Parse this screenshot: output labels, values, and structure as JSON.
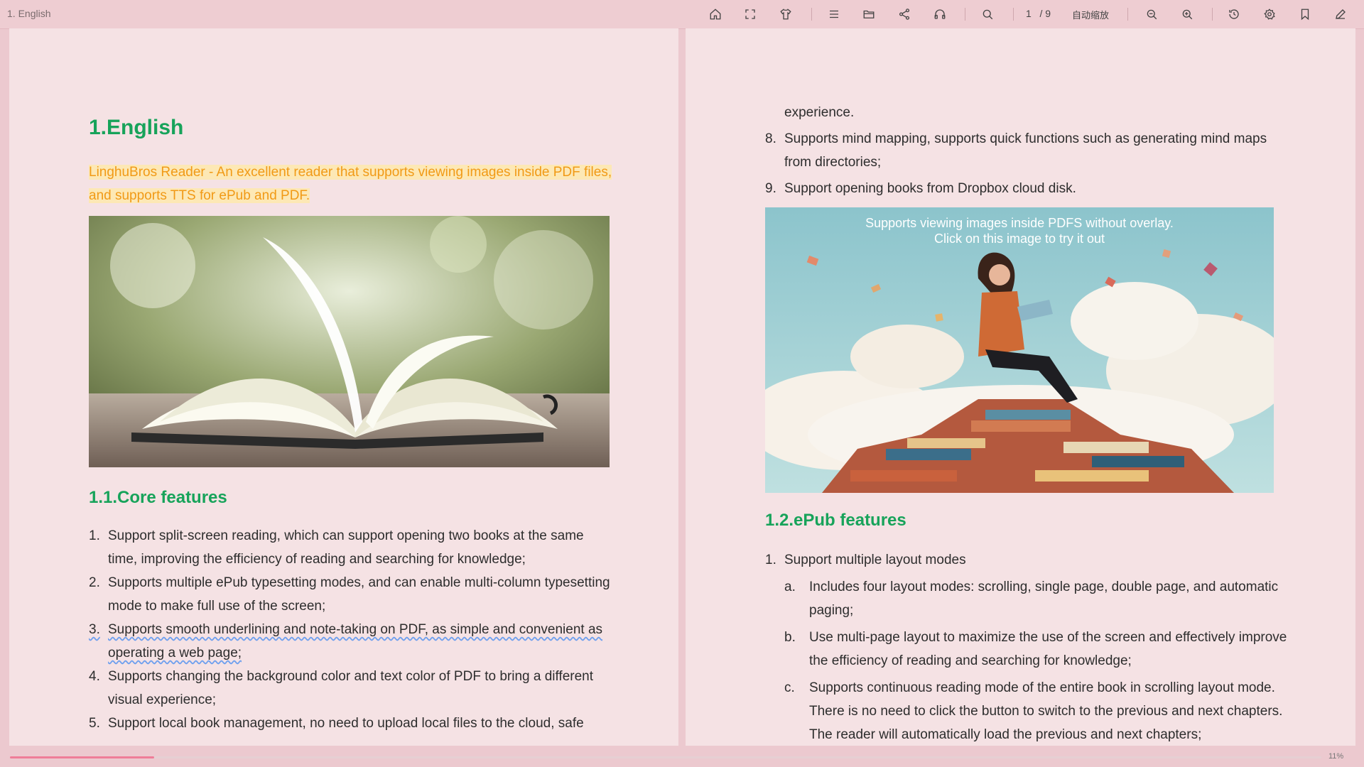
{
  "toolbar": {
    "chapter_title": "1. English",
    "current_page": "1",
    "page_total": "/ 9",
    "zoom_label": "自动缩放"
  },
  "progress": {
    "fraction": 0.11,
    "label": "11%"
  },
  "left_page": {
    "heading": "1.English",
    "intro": "LinghuBros Reader - An excellent reader that supports viewing images inside PDF files, and supports TTS for ePub and PDF.",
    "section_heading": "1.1.Core features",
    "items": [
      {
        "num": "1.",
        "text": "Support split-screen reading, which can support opening two books at the same time, improving the efficiency of reading and searching for knowledge;"
      },
      {
        "num": "2.",
        "text": "Supports multiple ePub typesetting modes, and can enable multi-column typesetting mode to make full use of the screen;"
      },
      {
        "num": "3.",
        "text": "Supports smooth underlining and note-taking on PDF, as simple and convenient as operating a web page;"
      },
      {
        "num": "4.",
        "text": "Supports changing the background color and text color of PDF to bring a different visual experience;"
      },
      {
        "num": "5.",
        "text": "Support local book management, no need to upload local files to the cloud, safe"
      }
    ]
  },
  "right_page": {
    "continued_text": "experience.",
    "items": [
      {
        "num": "8.",
        "text": "Supports mind mapping, supports quick functions such as generating mind maps from directories;"
      },
      {
        "num": "9.",
        "text": "Support opening books from Dropbox cloud disk."
      }
    ],
    "image_caption_line1": "Supports viewing images inside PDFS without overlay.",
    "image_caption_line2": "Click on this image to try it out",
    "section_heading": "1.2.ePub features",
    "epub_items": [
      {
        "num": "1.",
        "text": "Support multiple layout modes"
      }
    ],
    "sub_items": [
      {
        "num": "a.",
        "text": "Includes four layout modes: scrolling, single page, double page, and automatic paging;"
      },
      {
        "num": "b.",
        "text": "Use multi-page layout to maximize the use of the screen and effectively improve the efficiency of reading and searching for knowledge;"
      },
      {
        "num": "c.",
        "text": "Supports continuous reading mode of the entire book in scrolling layout mode. There is no need to click the button to switch to the previous and next chapters. The reader will automatically load the previous and next chapters;"
      }
    ]
  }
}
